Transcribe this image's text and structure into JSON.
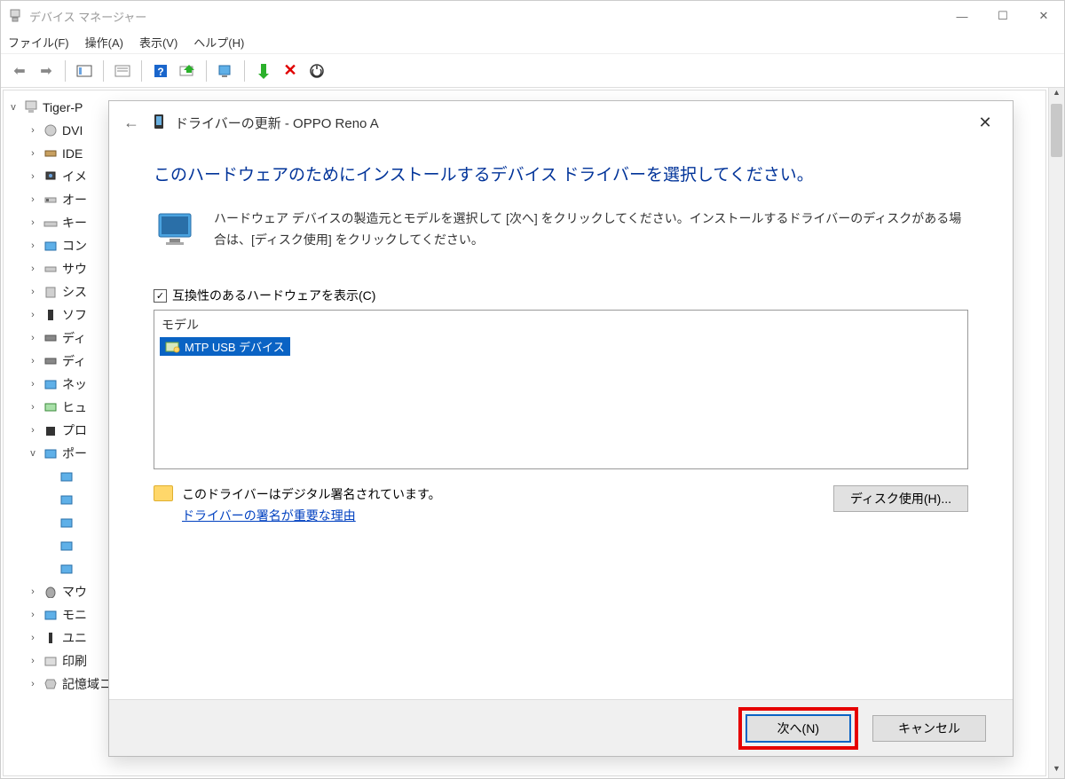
{
  "titlebar": {
    "title": "デバイス マネージャー"
  },
  "menubar": {
    "file": "ファイル(F)",
    "action": "操作(A)",
    "view": "表示(V)",
    "help": "ヘルプ(H)"
  },
  "tree": {
    "root": "Tiger-P",
    "items": [
      {
        "caret": ">",
        "label": "DVI"
      },
      {
        "caret": ">",
        "label": "IDE"
      },
      {
        "caret": ">",
        "label": "イメ"
      },
      {
        "caret": ">",
        "label": "オー"
      },
      {
        "caret": ">",
        "label": "キー"
      },
      {
        "caret": ">",
        "label": "コン"
      },
      {
        "caret": ">",
        "label": "サウ"
      },
      {
        "caret": ">",
        "label": "シス"
      },
      {
        "caret": ">",
        "label": "ソフ"
      },
      {
        "caret": ">",
        "label": "ディ"
      },
      {
        "caret": ">",
        "label": "ディ"
      },
      {
        "caret": ">",
        "label": "ネッ"
      },
      {
        "caret": ">",
        "label": "ヒュ"
      },
      {
        "caret": ">",
        "label": "プロ"
      },
      {
        "caret": "v",
        "label": "ポー",
        "children": [
          {
            "label": ""
          },
          {
            "label": ""
          },
          {
            "label": ""
          },
          {
            "label": ""
          },
          {
            "label": ""
          }
        ]
      },
      {
        "caret": ">",
        "label": "マウ"
      },
      {
        "caret": ">",
        "label": "モニ"
      },
      {
        "caret": ">",
        "label": "ユニ"
      },
      {
        "caret": ">",
        "label": "印刷"
      },
      {
        "caret": ">",
        "label": "記憶域コントローラー"
      }
    ]
  },
  "dialog": {
    "title": "ドライバーの更新 - OPPO Reno A",
    "heading": "このハードウェアのためにインストールするデバイス ドライバーを選択してください。",
    "instruction": "ハードウェア デバイスの製造元とモデルを選択して [次へ] をクリックしてください。インストールするドライバーのディスクがある場合は、[ディスク使用] をクリックしてください。",
    "compat_checkbox": "互換性のあるハードウェアを表示(C)",
    "model_header": "モデル",
    "model_item": "MTP USB デバイス",
    "signed_text": "このドライバーはデジタル署名されています。",
    "sign_link": "ドライバーの署名が重要な理由",
    "disk_button": "ディスク使用(H)...",
    "next_button": "次へ(N)",
    "cancel_button": "キャンセル"
  }
}
